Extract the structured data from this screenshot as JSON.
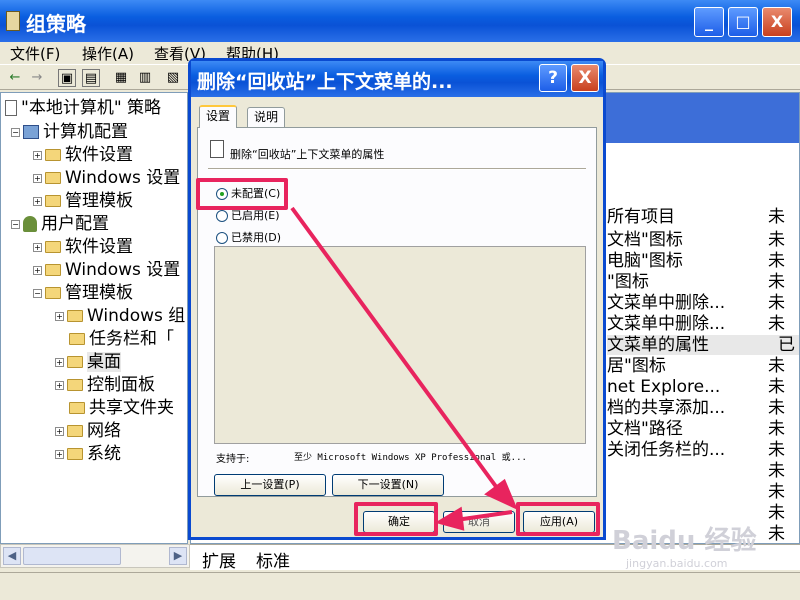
{
  "window": {
    "title": "组策略",
    "min": "_",
    "max": "□",
    "close": "X"
  },
  "menu": [
    "文件(F)",
    "操作(A)",
    "查看(V)",
    "帮助(H)"
  ],
  "tree": {
    "root": "\"本地计算机\" 策略",
    "items": [
      {
        "label": "计算机配置",
        "level": 1
      },
      {
        "label": "软件设置",
        "level": 2
      },
      {
        "label": "Windows 设置",
        "level": 2
      },
      {
        "label": "管理模板",
        "level": 2
      },
      {
        "label": "用户配置",
        "level": 1
      },
      {
        "label": "软件设置",
        "level": 2
      },
      {
        "label": "Windows 设置",
        "level": 2
      },
      {
        "label": "管理模板",
        "level": 2
      },
      {
        "label": "Windows 组",
        "level": 3
      },
      {
        "label": "任务栏和「",
        "level": 3
      },
      {
        "label": "桌面",
        "level": 3
      },
      {
        "label": "控制面板",
        "level": 3
      },
      {
        "label": "共享文件夹",
        "level": 3
      },
      {
        "label": "网络",
        "level": 3
      },
      {
        "label": "系统",
        "level": 3
      }
    ]
  },
  "right_list": {
    "items": [
      "所有项目",
      "文档\"图标",
      "电脑\"图标",
      "\"图标",
      "文菜单中删除...",
      "文菜单中删除...",
      "文菜单的属性",
      "居\"图标",
      "net Explore...",
      "档的共享添加...",
      "文档\"路径",
      "关闭任务栏的..."
    ],
    "states": [
      "未",
      "未",
      "未",
      "未",
      "未",
      "未",
      "已",
      "未",
      "未",
      "未",
      "未",
      "未",
      "未",
      "未",
      "未",
      "未"
    ]
  },
  "bottom_tabs": [
    "扩展",
    "标准"
  ],
  "dialog": {
    "title": "删除“回收站”上下文菜单的...",
    "help": "?",
    "close": "X",
    "tabs": [
      "设置",
      "说明"
    ],
    "policy_name": "删除“回收站”上下文菜单的属性",
    "options": [
      "未配置(C)",
      "已启用(E)",
      "已禁用(D)"
    ],
    "selected": 0,
    "supports_label": "支持于:",
    "supports_value": "至少 Microsoft Windows XP Professional 或...",
    "prev": "上一设置(P)",
    "next": "下一设置(N)",
    "ok": "确定",
    "cancel": "取消",
    "apply": "应用(A)"
  },
  "watermark": {
    "brand": "Baidu 经验",
    "url": "jingyan.baidu.com"
  },
  "colors": {
    "highlight": "#e8245e",
    "titlebar": "#0a5ee0"
  }
}
